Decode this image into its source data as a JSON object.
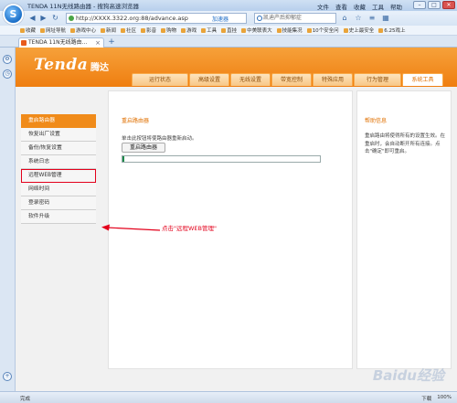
{
  "window": {
    "title": "TENDA 11N无线路由器 - 搜狗高速浏览器",
    "menus": [
      "文件",
      "查看",
      "收藏",
      "工具",
      "帮助"
    ]
  },
  "addressbar": {
    "url": "http://XXXX.3322.org:88/advance.asp",
    "accelerate": "加速器",
    "search_placeholder": "凯迪产后抑郁症"
  },
  "favorites": [
    "收藏",
    "网址导航",
    "游戏中心",
    "新闻",
    "社区",
    "影音",
    "购物",
    "游戏",
    "工具",
    "直挂",
    "中美联表大",
    "技能集况",
    "10个安全问",
    "史上最安全",
    "6.25戏上"
  ],
  "tab": {
    "label": "TENDA 11N无线路由..."
  },
  "router": {
    "brand": "Tenda",
    "brand_cn": "腾达",
    "nav_tabs": [
      {
        "label": "运行状态",
        "w": 62
      },
      {
        "label": "高级设置",
        "w": 44
      },
      {
        "label": "无线设置",
        "w": 44
      },
      {
        "label": "带宽控制",
        "w": 44
      },
      {
        "label": "特殊应用",
        "w": 44
      },
      {
        "label": "行为管理",
        "w": 52
      },
      {
        "label": "系统工具",
        "w": 45
      }
    ],
    "active_tab": 6,
    "side_menu": [
      "重启路由器",
      "恢复出厂设置",
      "备份/恢复设置",
      "系统日志",
      "远程WEB管理",
      "网络时间",
      "登录密码",
      "软件升级"
    ],
    "active_menu": 0,
    "highlight_menu": 4,
    "panel_title": "重启路由器",
    "panel_desc": "单击此按钮将使路由器重新启动。",
    "reboot_button": "重启路由器",
    "progress": 0.01,
    "help_title": "帮助信息",
    "help_text": "重启路由将使得所有的设置生效。在重启时，会自动断开所有连接。点击\"确定\"即可重启。"
  },
  "annotation": {
    "text": "点击\"远程WEB管理\""
  },
  "statusbar": {
    "left": "完成",
    "right": [
      "下载",
      "100%"
    ]
  },
  "watermark": "Baidu经验"
}
